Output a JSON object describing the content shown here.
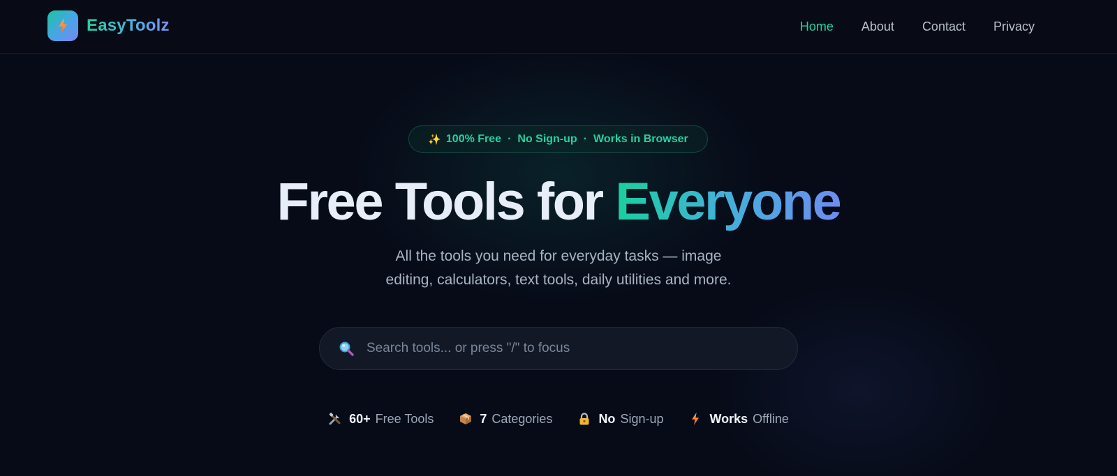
{
  "brand": {
    "name": "EasyToolz"
  },
  "nav": {
    "items": [
      {
        "label": "Home",
        "active": true
      },
      {
        "label": "About",
        "active": false
      },
      {
        "label": "Contact",
        "active": false
      },
      {
        "label": "Privacy",
        "active": false
      }
    ]
  },
  "hero": {
    "pill": {
      "icon": "sparkles-icon",
      "items": [
        "100% Free",
        "No Sign-up",
        "Works in Browser"
      ],
      "separator": "·"
    },
    "headline": {
      "prefix": "Free Tools for ",
      "accent": "Everyone"
    },
    "subtitle_line1": "All the tools you need for everyday tasks — image",
    "subtitle_line2": "editing, calculators, text tools, daily utilities and more."
  },
  "search": {
    "placeholder": "Search tools... or press \"/\" to focus",
    "value": "",
    "icon": "magnifier-icon"
  },
  "stats": [
    {
      "icon": "tools-icon",
      "strong": "60+",
      "label": "Free Tools"
    },
    {
      "icon": "package-icon",
      "strong": "7",
      "label": "Categories"
    },
    {
      "icon": "lock-icon",
      "strong": "No",
      "label": "Sign-up"
    },
    {
      "icon": "lightning-icon",
      "strong": "Works",
      "label": "Offline"
    }
  ],
  "colors": {
    "background": "#070b18",
    "accent": "#22d3a4",
    "accent_gradient_end": "#6d8df2",
    "text": "#e8eef7",
    "muted": "#a9b4c3"
  }
}
